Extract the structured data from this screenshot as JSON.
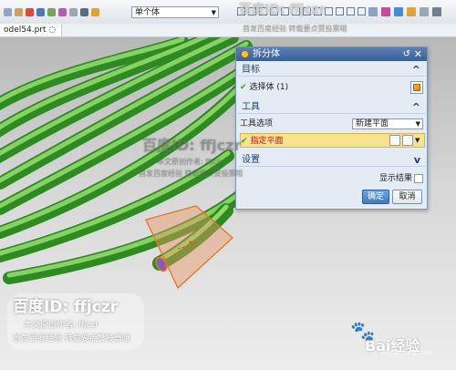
{
  "toolbar": {
    "top_clip_text": "...",
    "filter_value": "单个体",
    "accent_colors": {
      "orange": "#e0821a",
      "green": "#3a9d2f",
      "blue": "#3a5f96"
    }
  },
  "file_tab": {
    "label": "odel54.prt"
  },
  "dialog": {
    "title": "拆分体",
    "target": {
      "header": "目标",
      "select_body": "选择体 (1)"
    },
    "tool": {
      "header": "工具",
      "tool_option_label": "工具选项",
      "tool_option_value": "新建平面",
      "specify_plane": "指定平面"
    },
    "settings": {
      "header": "设置"
    },
    "preview_label": "显示结果",
    "ok": "确定",
    "cancel": "取消"
  },
  "watermark": {
    "top_id": "百度ID: ffjczr",
    "top_sub": "首发百度经验 转载要点赞投票哦",
    "mid_id": "百度ID: ffjczr",
    "mid_a": "本文原创作者: ffjczr",
    "mid_b": "首发百度经验 转载要点赞投票哦",
    "bl_id": "百度ID: ffjczr",
    "bl_a": "本文原创作者: ffjczr",
    "bl_b": "首发百度经验 转载要点赞投票哦",
    "baidu_logo": "Bai经验",
    "baidu_sub": "jingyan.baidu.com"
  },
  "icons": [
    "gear-icon",
    "reset-icon",
    "close-icon",
    "check-icon",
    "cube-icon",
    "chevron-up-icon",
    "chevron-down-icon",
    "plane-icon",
    "magnifier-icon",
    "paw-icon"
  ]
}
